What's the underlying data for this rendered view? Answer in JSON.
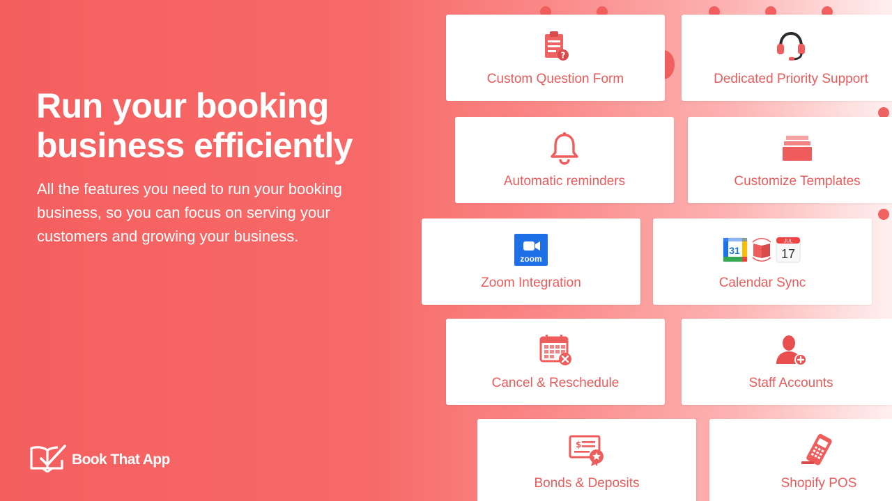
{
  "hero": {
    "title": "Run your booking\nbusiness efficiently",
    "description": "All the features you need to run your booking business, so you can focus on serving your customers and growing your business."
  },
  "brand": {
    "name": "Book That App",
    "logo_icon": "open-book-check-icon"
  },
  "colors": {
    "accent": "#ef5b5b",
    "card_text": "#e95b5b",
    "background_start": "#f45f5e",
    "background_end": "#fff0f0"
  },
  "features": [
    {
      "label": "Custom Question Form",
      "icon": "clipboard-question-icon"
    },
    {
      "label": "Dedicated Priority Support",
      "icon": "headset-icon"
    },
    {
      "label": "Automatic reminders",
      "icon": "bell-icon"
    },
    {
      "label": "Customize Templates",
      "icon": "template-stack-icon"
    },
    {
      "label": "Zoom Integration",
      "icon": "zoom-icon",
      "icon_text": "zoom"
    },
    {
      "label": "Calendar Sync",
      "icon": "calendar-sync-icon",
      "icon_text": [
        "31",
        "JUL",
        "17"
      ]
    },
    {
      "label": "Cancel & Reschedule",
      "icon": "calendar-cancel-icon"
    },
    {
      "label": "Staff Accounts",
      "icon": "add-user-icon"
    },
    {
      "label": "Bonds & Deposits",
      "icon": "certificate-icon"
    },
    {
      "label": "Shopify POS",
      "icon": "card-reader-icon"
    }
  ]
}
